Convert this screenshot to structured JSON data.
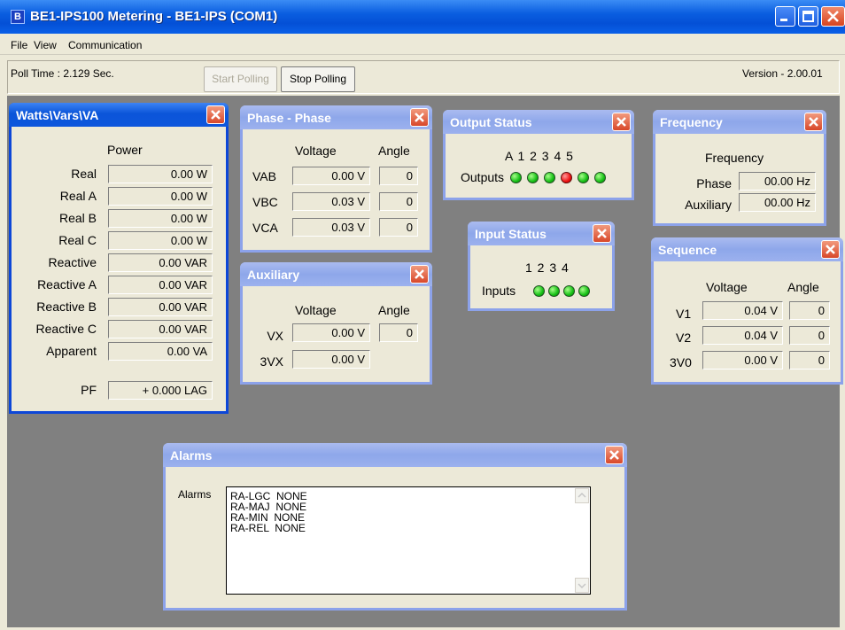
{
  "window": {
    "title": "BE1-IPS100 Metering - BE1-IPS (COM1)",
    "app_icon": "B"
  },
  "menu": [
    "File",
    "View",
    "Communication"
  ],
  "toolbar": {
    "poll_time": "Poll Time : 2.129 Sec.",
    "start_polling": "Start Polling",
    "stop_polling": "Stop Polling",
    "version": "Version - 2.00.01"
  },
  "watts": {
    "title": "Watts\\Vars\\VA",
    "header": "Power",
    "rows": [
      {
        "label": "Real",
        "value": "0.00 W"
      },
      {
        "label": "Real A",
        "value": "0.00 W"
      },
      {
        "label": "Real B",
        "value": "0.00 W"
      },
      {
        "label": "Real C",
        "value": "0.00 W"
      },
      {
        "label": "Reactive",
        "value": "0.00 VAR"
      },
      {
        "label": "Reactive A",
        "value": "0.00 VAR"
      },
      {
        "label": "Reactive B",
        "value": "0.00 VAR"
      },
      {
        "label": "Reactive C",
        "value": "0.00 VAR"
      },
      {
        "label": "Apparent",
        "value": "0.00 VA"
      }
    ],
    "pf_label": "PF",
    "pf_value": "+ 0.000 LAG"
  },
  "phase": {
    "title": "Phase - Phase",
    "col_voltage": "Voltage",
    "col_angle": "Angle",
    "rows": [
      {
        "label": "VAB",
        "voltage": "0.00 V",
        "angle": "0"
      },
      {
        "label": "VBC",
        "voltage": "0.03 V",
        "angle": "0"
      },
      {
        "label": "VCA",
        "voltage": "0.03 V",
        "angle": "0"
      }
    ]
  },
  "auxiliary": {
    "title": "Auxiliary",
    "col_voltage": "Voltage",
    "col_angle": "Angle",
    "vx_label": "VX",
    "vx_voltage": "0.00 V",
    "vx_angle": "0",
    "v3x_label": "3VX",
    "v3x_voltage": "0.00 V"
  },
  "output": {
    "title": "Output Status",
    "headers": "A  1  2  3  4  5",
    "label": "Outputs",
    "states": [
      "green",
      "green",
      "green",
      "red",
      "green",
      "green"
    ]
  },
  "input": {
    "title": "Input Status",
    "headers": "1  2  3  4",
    "label": "Inputs",
    "states": [
      "green",
      "green",
      "green",
      "green"
    ]
  },
  "frequency": {
    "title": "Frequency",
    "header": "Frequency",
    "phase_label": "Phase",
    "phase_value": "00.00 Hz",
    "aux_label": "Auxiliary",
    "aux_value": "00.00 Hz"
  },
  "sequence": {
    "title": "Sequence",
    "col_voltage": "Voltage",
    "col_angle": "Angle",
    "rows": [
      {
        "label": "V1",
        "voltage": "0.04 V",
        "angle": "0"
      },
      {
        "label": "V2",
        "voltage": "0.04 V",
        "angle": "0"
      },
      {
        "label": "3V0",
        "voltage": "0.00 V",
        "angle": "0"
      }
    ]
  },
  "alarms": {
    "title": "Alarms",
    "label": "Alarms",
    "lines": [
      "RA-LGC  NONE",
      "RA-MAJ  NONE",
      "RA-MIN  NONE",
      "RA-REL  NONE"
    ]
  },
  "colors": {
    "title_bar": "#0a5ee0",
    "mdi_background": "#808080",
    "led_green": "#16c016",
    "led_red": "#ee1111"
  },
  "icons": [
    "minimize-icon",
    "maximize-icon",
    "close-icon",
    "scroll-up-icon",
    "scroll-down-icon"
  ]
}
